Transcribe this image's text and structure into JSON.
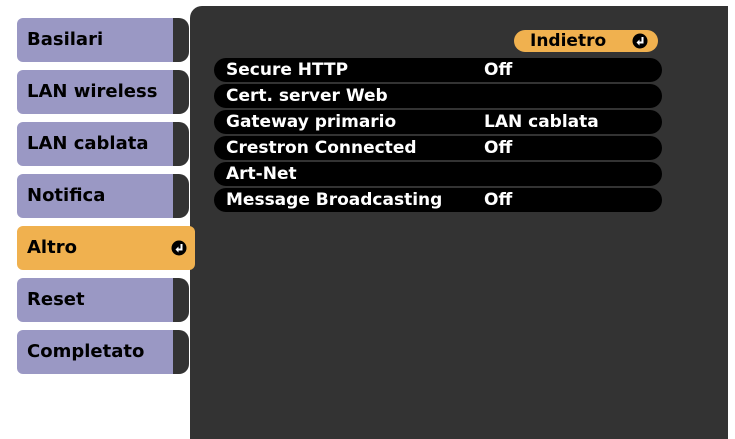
{
  "sidebar": {
    "items": [
      {
        "label": "Basilari"
      },
      {
        "label": "LAN wireless"
      },
      {
        "label": "LAN cablata"
      },
      {
        "label": "Notifica"
      },
      {
        "label": "Altro"
      },
      {
        "label": "Reset"
      },
      {
        "label": "Completato"
      }
    ]
  },
  "panel": {
    "back_label": "Indietro",
    "rows": [
      {
        "label": "Secure HTTP",
        "value": "Off"
      },
      {
        "label": "Cert. server Web",
        "value": ""
      },
      {
        "label": "Gateway primario",
        "value": "LAN cablata"
      },
      {
        "label": "Crestron Connected",
        "value": "Off"
      },
      {
        "label": "Art-Net",
        "value": ""
      },
      {
        "label": "Message Broadcasting",
        "value": "Off"
      }
    ]
  },
  "colors": {
    "tab": "#9a98c4",
    "active": "#f0b14f",
    "panel": "#333333",
    "row": "#000000"
  },
  "icons": {
    "enter": "enter-return-icon"
  }
}
